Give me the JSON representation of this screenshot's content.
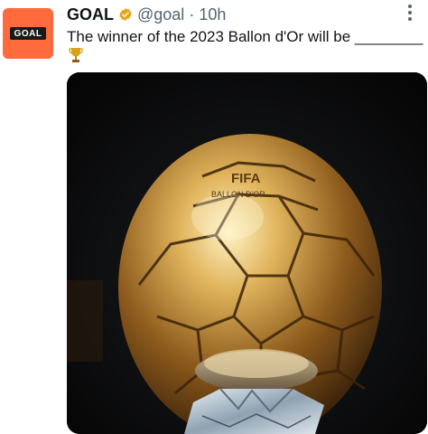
{
  "tweet": {
    "author_name": "GOAL",
    "handle": "@goal",
    "separator": "·",
    "time": "10h",
    "text": "The winner of the 2023 Ballon d'Or will be ________",
    "emoji_icon": "trophy-icon"
  },
  "avatar": {
    "logo_text": "GOAL",
    "brand_color": "#ff6b3d"
  },
  "media": {
    "ball_text_line1": "FIFA",
    "ball_text_line2": "BALLON D'OR"
  },
  "colors": {
    "verified_badge": "#e8a317",
    "secondary_text": "#536471"
  }
}
